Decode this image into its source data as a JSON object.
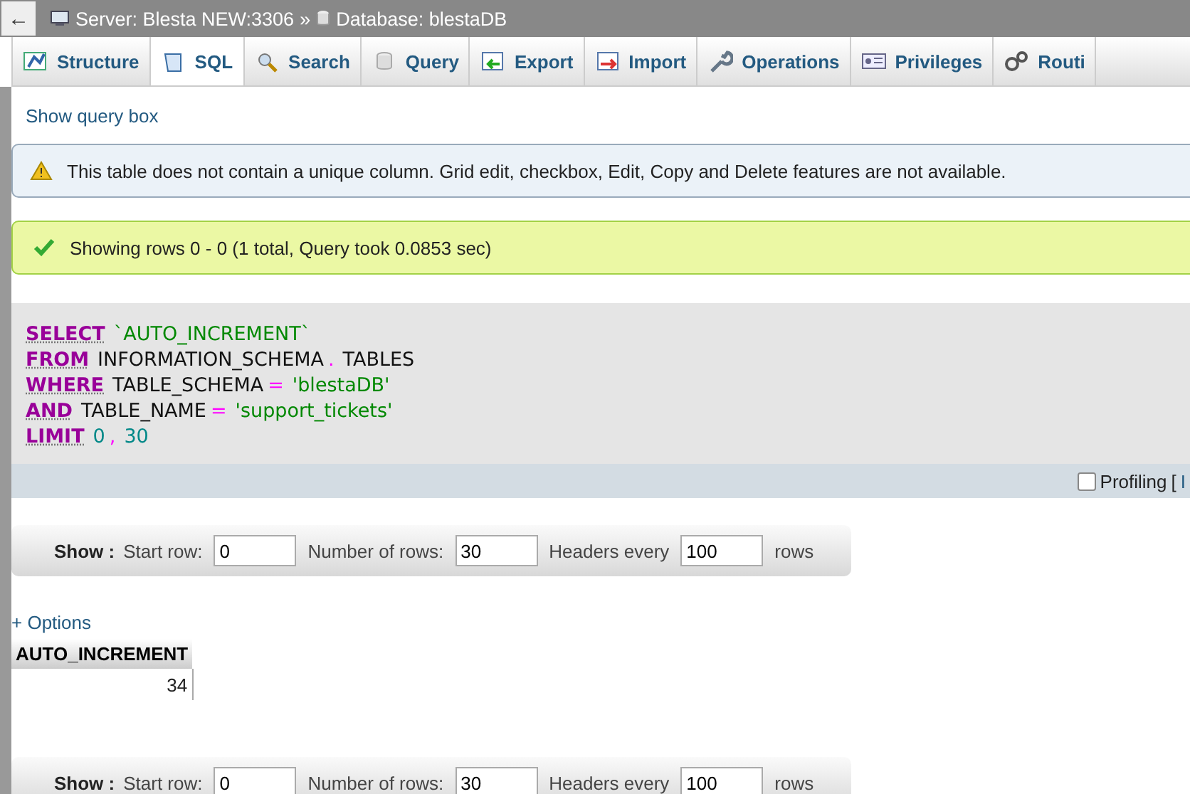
{
  "breadcrumb": {
    "back": "←",
    "server": "Server: Blesta NEW:3306",
    "separator": "»",
    "database": "Database: blestaDB"
  },
  "tabs": [
    {
      "label": "Structure",
      "selected": false
    },
    {
      "label": "SQL",
      "selected": true
    },
    {
      "label": "Search",
      "selected": false
    },
    {
      "label": "Query",
      "selected": false
    },
    {
      "label": "Export",
      "selected": false
    },
    {
      "label": "Import",
      "selected": false
    },
    {
      "label": "Operations",
      "selected": false
    },
    {
      "label": "Privileges",
      "selected": false
    },
    {
      "label": "Routi",
      "selected": false
    }
  ],
  "show_query_box": "Show query box",
  "notice": "This table does not contain a unique column. Grid edit, checkbox, Edit, Copy and Delete features are not available.",
  "success": "Showing rows 0 - 0 (1 total, Query took 0.0853 sec)",
  "sql_lines": [
    [
      {
        "kind": "keyword",
        "text": "SELECT"
      },
      {
        "kind": "string",
        "text": "`AUTO_INCREMENT`"
      }
    ],
    [
      {
        "kind": "keyword",
        "text": "FROM"
      },
      {
        "kind": "plain",
        "text": "INFORMATION_SCHEMA"
      },
      {
        "kind": "operator",
        "text": "."
      },
      {
        "kind": "plain",
        "text": "TABLES"
      }
    ],
    [
      {
        "kind": "keyword",
        "text": "WHERE"
      },
      {
        "kind": "plain",
        "text": "TABLE_SCHEMA"
      },
      {
        "kind": "operator",
        "text": "="
      },
      {
        "kind": "string",
        "text": "'blestaDB'"
      }
    ],
    [
      {
        "kind": "keyword",
        "text": "AND"
      },
      {
        "kind": "plain",
        "text": "TABLE_NAME"
      },
      {
        "kind": "operator",
        "text": "="
      },
      {
        "kind": "string",
        "text": "'support_tickets'"
      }
    ],
    [
      {
        "kind": "keyword",
        "text": "LIMIT"
      },
      {
        "kind": "number",
        "text": "0"
      },
      {
        "kind": "operator",
        "text": ","
      },
      {
        "kind": "number",
        "text": "30"
      }
    ]
  ],
  "profiling": {
    "label": "Profiling",
    "checked": false,
    "bracket": "[",
    "link": "I"
  },
  "nav_bars": [
    {
      "show": "Show :",
      "start_label": "Start row:",
      "start": "0",
      "rows_label": "Number of rows:",
      "rows": "30",
      "headers_label": "Headers every",
      "headers": "100",
      "suffix": "rows"
    },
    {
      "show": "Show :",
      "start_label": "Start row:",
      "start": "0",
      "rows_label": "Number of rows:",
      "rows": "30",
      "headers_label": "Headers every",
      "headers": "100",
      "suffix": "rows"
    }
  ],
  "options_link": "+ Options",
  "table": {
    "columns": [
      "AUTO_INCREMENT"
    ],
    "rows": [
      [
        "34"
      ]
    ]
  }
}
